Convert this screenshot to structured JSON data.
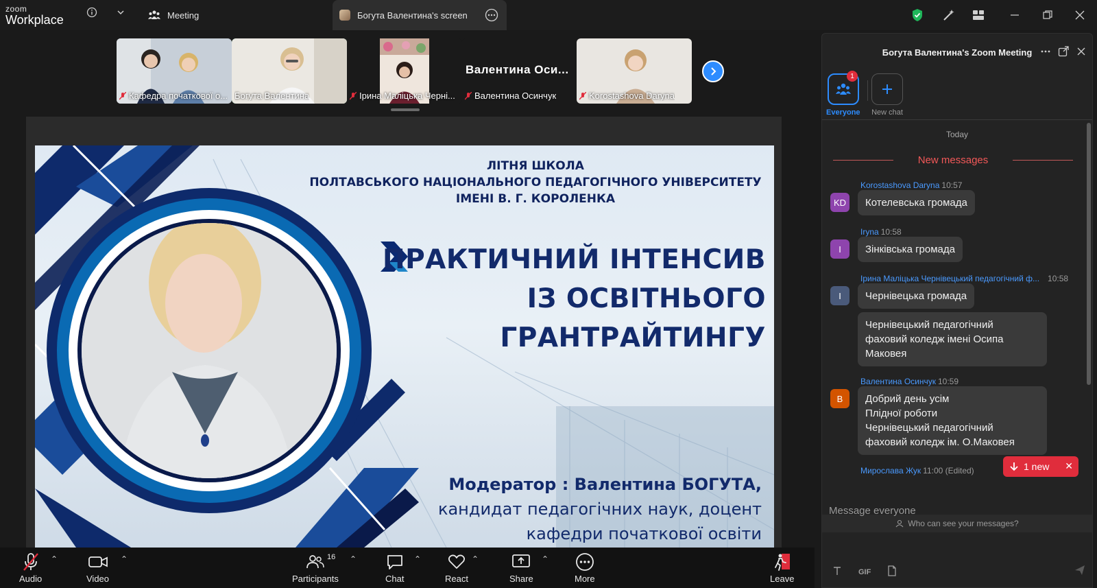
{
  "titlebar": {
    "logo_top": "zoom",
    "logo_bottom": "Workplace",
    "meeting_tab": "Meeting",
    "screen_tab": "Богута Валентина's screen"
  },
  "thumbnails": [
    {
      "label": "Кафедра початкової о..."
    },
    {
      "label": "Богута Валентина"
    },
    {
      "label": "Ірина Маліцька Черні..."
    },
    {
      "label": "Валентина Осинчук",
      "display_name": "Валентина  Оси..."
    },
    {
      "label": "Korostashova Daryna"
    }
  ],
  "slide": {
    "header_line1": "ЛІТНЯ ШКОЛА",
    "header_line2": "ПОЛТАВСЬКОГО НАЦІОНАЛЬНОГО ПЕДАГОГІЧНОГО УНІВЕРСИТЕТУ",
    "header_line3": "ІМЕНІ В. Г. КОРОЛЕНКА",
    "title_line1": "ПРАКТИЧНИЙ ІНТЕНСИВ",
    "title_line2": "ІЗ ОСВІТНЬОГО",
    "title_line3": "ГРАНТРАЙТИНГУ",
    "moderator_line1": "Модератор : Валентина БОГУТА,",
    "moderator_line2": "кандидат педагогічних наук, доцент",
    "moderator_line3": "кафедри початкової освіти"
  },
  "toolbar": {
    "audio": "Audio",
    "video": "Video",
    "participants": "Participants",
    "participants_count": "16",
    "chat": "Chat",
    "react": "React",
    "share": "Share",
    "more": "More",
    "leave": "Leave"
  },
  "chat": {
    "title": "Богута Валентина's Zoom Meeting",
    "everyone": "Everyone",
    "everyone_badge": "1",
    "new_chat": "New chat",
    "today": "Today",
    "new_messages": "New messages",
    "messages": [
      {
        "avatar": "KD",
        "avatar_color": "#8e44ad",
        "sender": "Korostashova Daryna",
        "time": "10:57",
        "text": "Котелевська громада"
      },
      {
        "avatar": "I",
        "avatar_color": "#8e44ad",
        "sender": "Iryna",
        "time": "10:58",
        "text": "Зінківська громада"
      },
      {
        "avatar": "I",
        "avatar_color": "#4a5a7a",
        "sender": "Ірина Маліцька Чернівецький педагогічний ф...",
        "time": "10:58",
        "text": "Чернівецька громада",
        "text2_line1": "Чернівецький педагогічний",
        "text2_line2": "фаховий коледж імені Осипа",
        "text2_line3": "Маковея"
      },
      {
        "avatar": "В",
        "avatar_color": "#d35400",
        "sender": "Валентина Осинчук",
        "time": "10:59",
        "line1": "Добрий  день усім",
        "line2": "Плідної роботи",
        "line3": "Чернівецький педагогічний",
        "line4": "фаховий коледж ім. О.Маковея"
      },
      {
        "sender": "Мирослава Жук",
        "time": "11:00 (Edited)"
      }
    ],
    "one_new": "1 new",
    "who_can_see": "Who can see your messages?",
    "placeholder": "Message everyone",
    "gif": "GIF"
  }
}
